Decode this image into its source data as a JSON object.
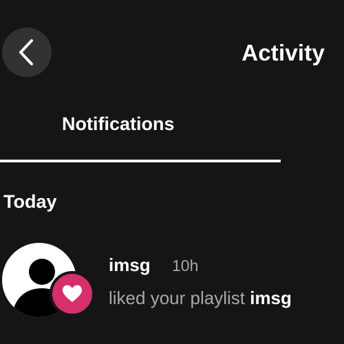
{
  "header": {
    "title": "Activity",
    "back_icon": "chevron-left-icon"
  },
  "tabs": [
    {
      "label": "Notifications",
      "active": true
    }
  ],
  "sections": [
    {
      "heading": "Today",
      "items": [
        {
          "username": "imsg",
          "time": "10h",
          "action": "liked your playlist",
          "playlist": "imsg",
          "avatar_icon": "user-silhouette-icon",
          "badge_icon": "heart-icon"
        }
      ]
    }
  ],
  "colors": {
    "background": "#161516",
    "back_button": "#333233",
    "secondary_text": "#a9a8a9",
    "heart_badge": "#d62f6b"
  }
}
